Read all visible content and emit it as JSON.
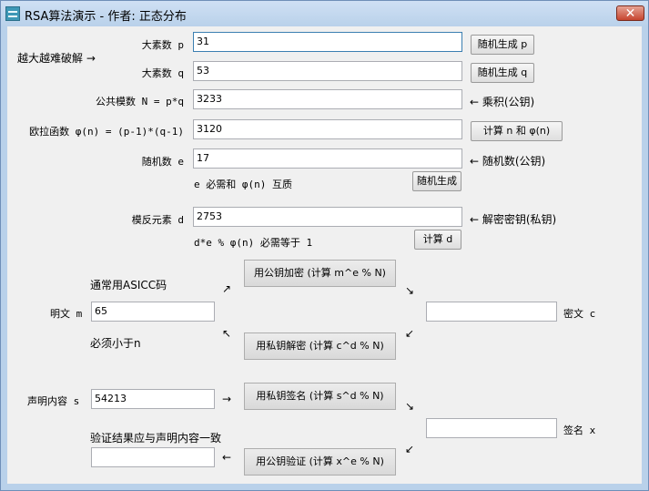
{
  "window": {
    "title": "RSA算法演示 - 作者: 正态分布",
    "close_label": "✕"
  },
  "hint_harder": "越大越难破解 →",
  "p": {
    "label": "大素数 p",
    "value": "31",
    "button": "随机生成 p"
  },
  "q": {
    "label": "大素数 q",
    "value": "53",
    "button": "随机生成 q"
  },
  "n": {
    "label": "公共模数 N = p*q",
    "value": "3233",
    "note": "← 乘积(公钥)"
  },
  "phi": {
    "label": "欧拉函数 φ(n) = (p-1)*(q-1)",
    "value": "3120",
    "button": "计算 n 和 φ(n)"
  },
  "e": {
    "label": "随机数 e",
    "value": "17",
    "note": "← 随机数(公钥)",
    "hint": "e 必需和 φ(n) 互质",
    "button": "随机生成"
  },
  "d": {
    "label": "模反元素 d",
    "value": "2753",
    "note": "← 解密密钥(私钥)",
    "hint": "d*e % φ(n) 必需等于 1",
    "button": "计算 d"
  },
  "encrypt": {
    "hint_top": "通常用ASICC码",
    "plaintext_label": "明文 m",
    "plaintext_value": "65",
    "hint_bottom": "必须小于n",
    "encrypt_button": "用公钥加密 (计算 m^e % N)",
    "decrypt_button": "用私钥解密 (计算 c^d % N)",
    "ciphertext_label": "密文 c",
    "ciphertext_value": ""
  },
  "sign": {
    "statement_label": "声明内容 s",
    "statement_value": "54213",
    "sign_button": "用私钥签名 (计算 s^d % N)",
    "signature_label": "签名 x",
    "signature_value": "",
    "verify_hint": "验证结果应与声明内容一致",
    "verify_button": "用公钥验证 (计算 x^e % N)",
    "verify_value": ""
  },
  "arrows": {
    "up_right": "↗",
    "down_right": "↘",
    "down_left": "↙",
    "up_left": "↖",
    "right": "→",
    "left": "←"
  }
}
